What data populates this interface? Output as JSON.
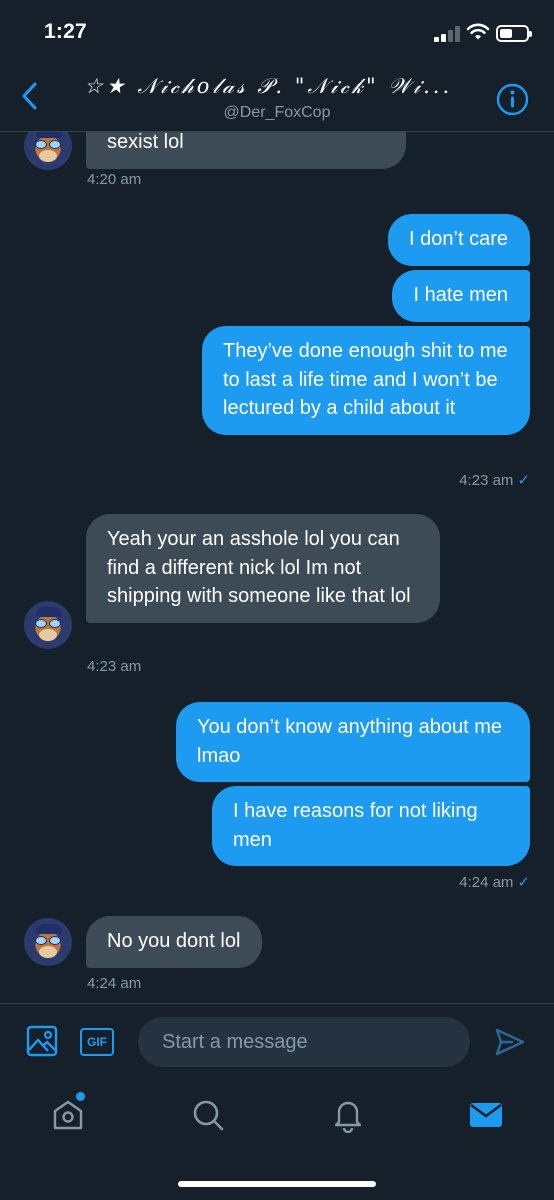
{
  "status_bar": {
    "time": "1:27"
  },
  "header": {
    "title": "☆★ 𝒩𝒾𝒸𝒽𝑜𝓁𝒶𝓈 𝒫. \"𝒩𝒾𝒸𝓀\" 𝒲𝒾...",
    "handle": "@Der_FoxCop",
    "back_icon": "chevron-left-icon",
    "info_icon": "info-icon"
  },
  "messages": [
    {
      "direction": "in",
      "text": "sexist lol"
    },
    {
      "type": "timestamp",
      "direction": "in",
      "text": "4:20 am"
    },
    {
      "direction": "out",
      "text": "I don’t care"
    },
    {
      "direction": "out",
      "text": "I hate men"
    },
    {
      "direction": "out",
      "text": "They’ve done enough shit to me to last a life time and I won’t be lectured by a child about it"
    },
    {
      "type": "timestamp",
      "direction": "out",
      "text": "4:23 am",
      "read": true
    },
    {
      "direction": "in",
      "text": "Yeah your an asshole lol you can find a different nick lol Im not shipping with someone like that lol"
    },
    {
      "type": "timestamp",
      "direction": "in",
      "text": "4:23 am"
    },
    {
      "direction": "out",
      "text": "You don’t know anything about me lmao"
    },
    {
      "direction": "out",
      "text": "I have reasons for not liking men"
    },
    {
      "type": "timestamp",
      "direction": "out",
      "text": "4:24 am",
      "read": true
    },
    {
      "direction": "in",
      "text": "No you dont lol"
    },
    {
      "type": "timestamp",
      "direction": "in",
      "text": "4:24 am"
    }
  ],
  "composer": {
    "placeholder": "Start a message",
    "gif_label": "GIF",
    "media_icon": "image-icon",
    "send_icon": "send-icon"
  },
  "tabbar": {
    "items": [
      "home-icon",
      "search-icon",
      "bell-icon",
      "mail-icon"
    ],
    "active": "mail-icon",
    "accent": "#1d9bf0"
  },
  "colors": {
    "background": "#15202b",
    "incoming_bubble": "#3d4b57",
    "outgoing_bubble": "#1d9bf0",
    "muted_text": "#8899a6"
  }
}
